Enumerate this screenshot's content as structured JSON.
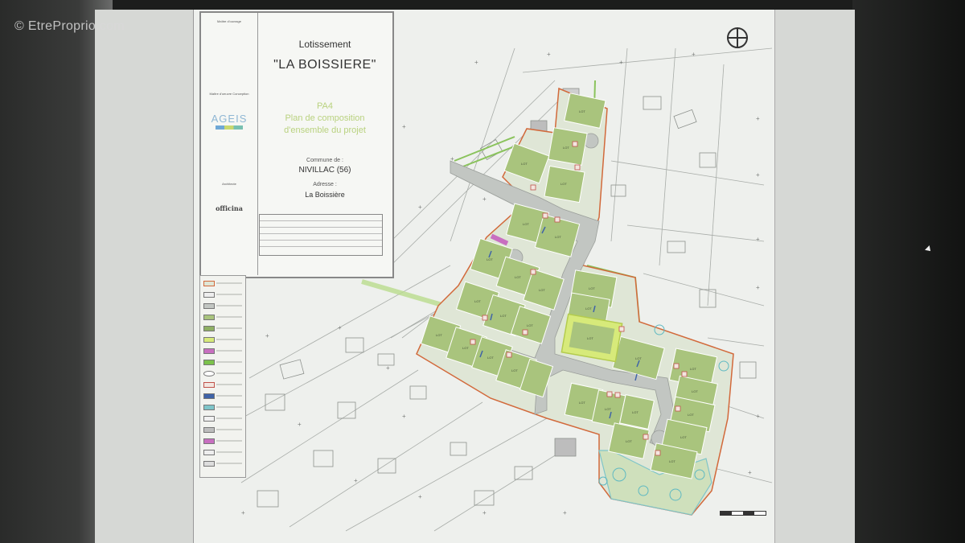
{
  "watermark": "© EtreProprio.com",
  "cartouche": {
    "maitre_ouvrage": "Maître d'ouvrage",
    "maitre_oeuvre": "Maître d'oeuvre Conception",
    "architecte": "Architecte",
    "agies_logo": "AGEIS",
    "officina_logo": "officina",
    "title_line1": "Lotissement",
    "title_line2": "\"LA BOISSIERE\"",
    "doc_code": "PA4",
    "doc_desc_line1": "Plan de composition",
    "doc_desc_line2": "d'ensemble du projet",
    "commune_label": "Commune de :",
    "commune_value": "NIVILLAC (56)",
    "adresse_label": "Adresse :",
    "adresse_value": "La Boissière"
  },
  "colors": {
    "lot_fill": "#a9c47d",
    "lot_dark": "#8fb064",
    "boundary": "#d2693b",
    "green_edge": "#7cc24c",
    "road": "#c2c6c2",
    "sheet": "#eef0ed"
  },
  "icons": {
    "north": "north-arrow-icon",
    "cursor": "mouse-cursor-icon"
  }
}
